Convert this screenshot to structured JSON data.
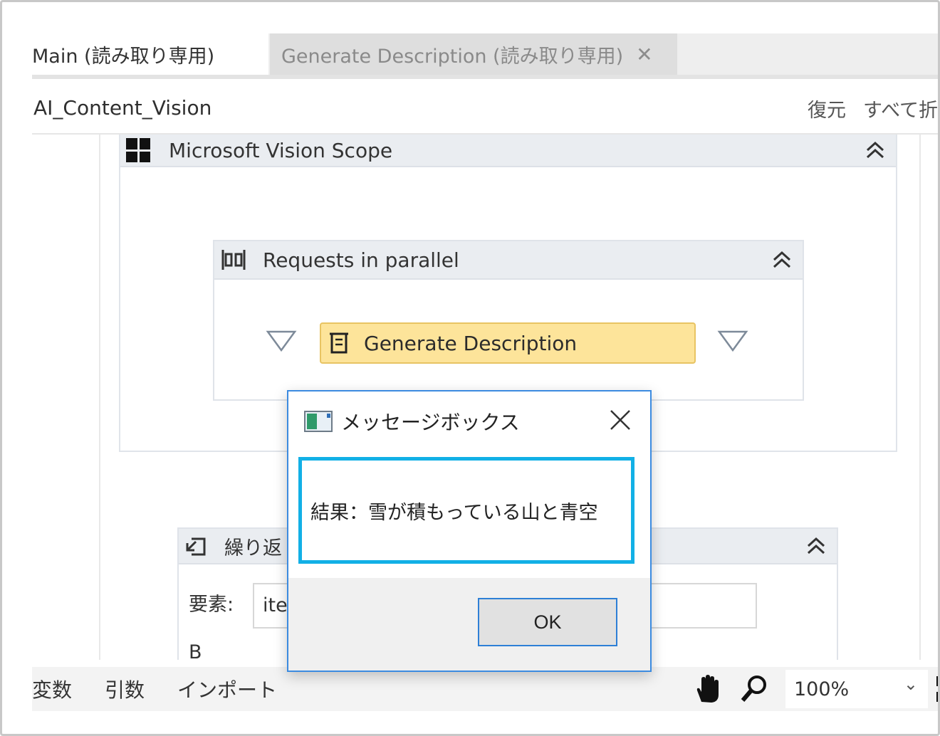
{
  "tabs": [
    {
      "label": "Main (読み取り専用)"
    },
    {
      "label": "Generate Description (読み取り専用)",
      "close": "✕"
    }
  ],
  "breadcrumb": "AI_Content_Vision",
  "header_actions": {
    "restore": "復元",
    "collapse_all": "すべて折"
  },
  "designer": {
    "scope": {
      "title": "Microsoft Vision Scope",
      "icon": "windows-logo-icon"
    },
    "parallel": {
      "title": "Requests in parallel",
      "icon": "parallel-icon"
    },
    "activity": {
      "title": "Generate Description",
      "icon": "flask-icon"
    },
    "loop": {
      "title": "繰り返",
      "element_label": "要素:",
      "element_value": "ite",
      "body_label": "B"
    }
  },
  "statusbar": {
    "variables": "変数",
    "arguments": "引数",
    "imports": "インポート",
    "zoom": "100%",
    "zoom_chevron": "⌄"
  },
  "dialog": {
    "title": "メッセージボックス",
    "message": "結果：雪が積もっている山と青空",
    "ok_label": "OK"
  },
  "colors": {
    "activity_fill": "#fde49a",
    "highlight": "#12b0e6",
    "dialog_border": "#3c8be0"
  }
}
